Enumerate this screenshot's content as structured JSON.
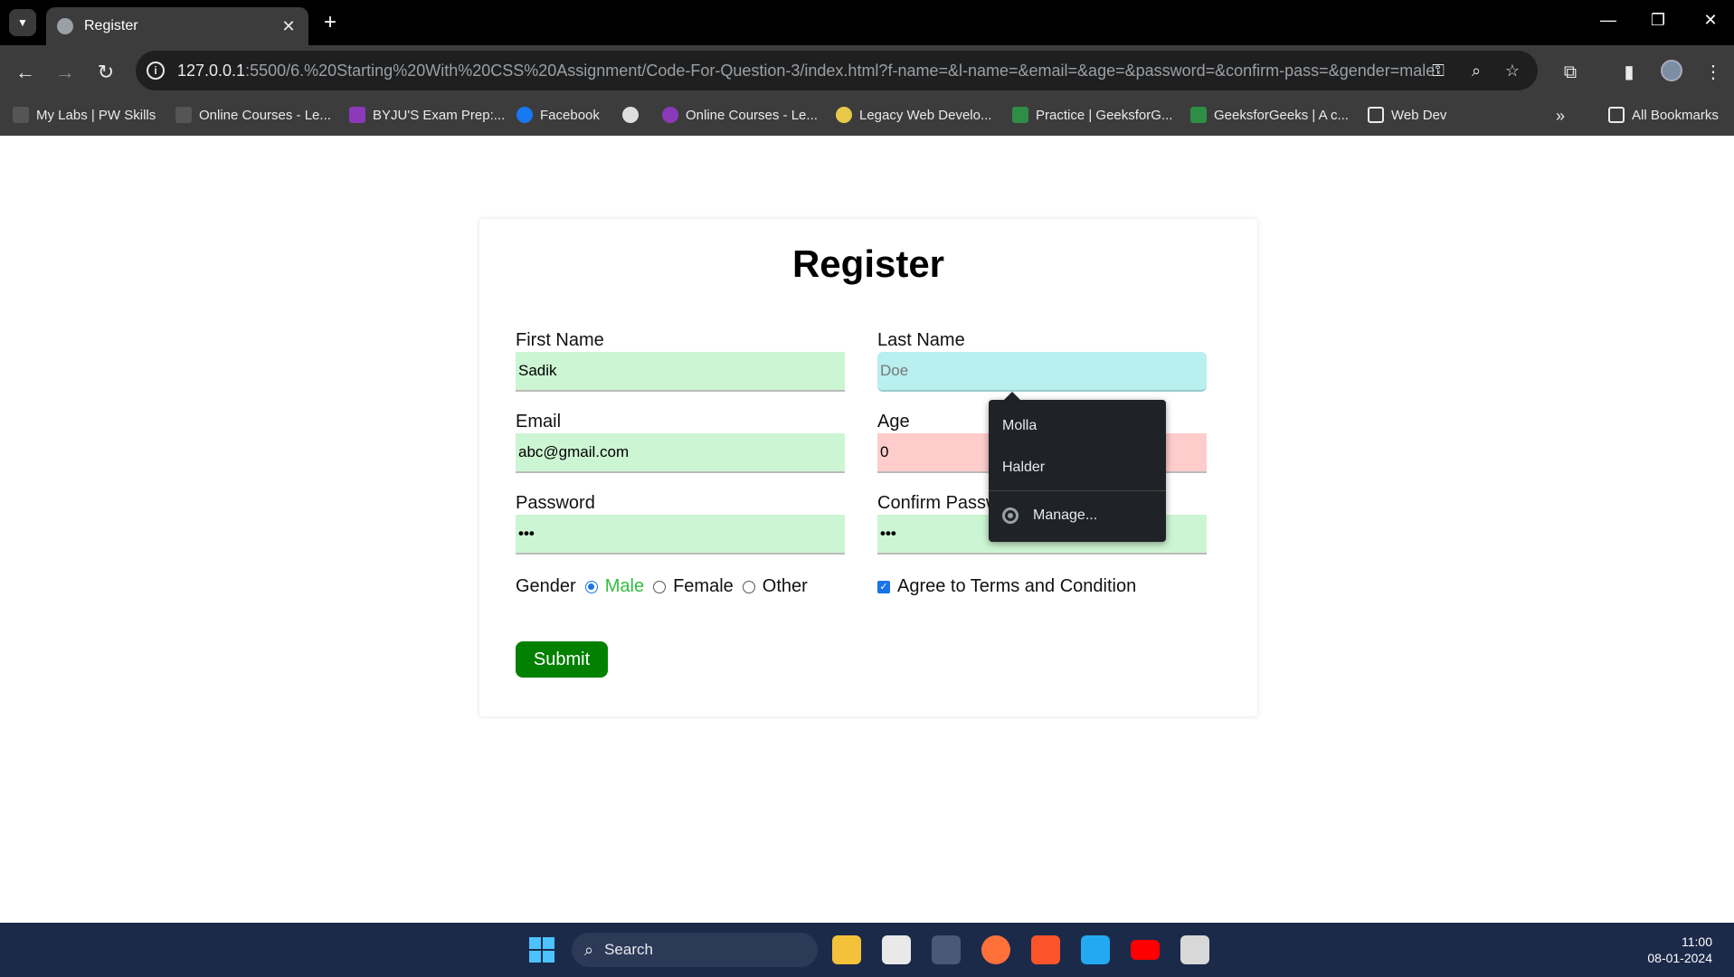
{
  "browser": {
    "tab_title": "Register",
    "new_tab": "+",
    "url_host": "127.0.0.1",
    "url_rest": ":5500/6.%20Starting%20With%20CSS%20Assignment/Code-For-Question-3/index.html?f-name=&l-name=&email=&age=&password=&confirm-pass=&gender=male",
    "bookmarks": [
      "My Labs | PW Skills",
      "Online Courses - Le...",
      "BYJU'S Exam Prep:...",
      "Facebook",
      "Online Courses - Le...",
      "Legacy Web Develo...",
      "Practice | GeeksforG...",
      "GeeksforGeeks | A c...",
      "Web Dev"
    ],
    "more_bookmarks": "»",
    "all_bookmarks": "All Bookmarks"
  },
  "form": {
    "title": "Register",
    "first_name_label": "First Name",
    "first_name_value": "Sadik",
    "last_name_label": "Last Name",
    "last_name_placeholder": "Doe",
    "email_label": "Email",
    "email_value": "abc@gmail.com",
    "age_label": "Age",
    "age_value": "0",
    "password_label": "Password",
    "password_value": "•••",
    "confirm_label": "Confirm Passw",
    "confirm_value": "•••",
    "gender_label": "Gender",
    "gender_options": [
      "Male",
      "Female",
      "Other"
    ],
    "gender_selected": "Male",
    "agree_label": "Agree to Terms and Condition",
    "submit_label": "Submit"
  },
  "autofill": {
    "options": [
      "Molla",
      "Halder"
    ],
    "manage": "Manage..."
  },
  "taskbar": {
    "search": "Search",
    "time": "11:00",
    "date": "08-01-2024"
  }
}
